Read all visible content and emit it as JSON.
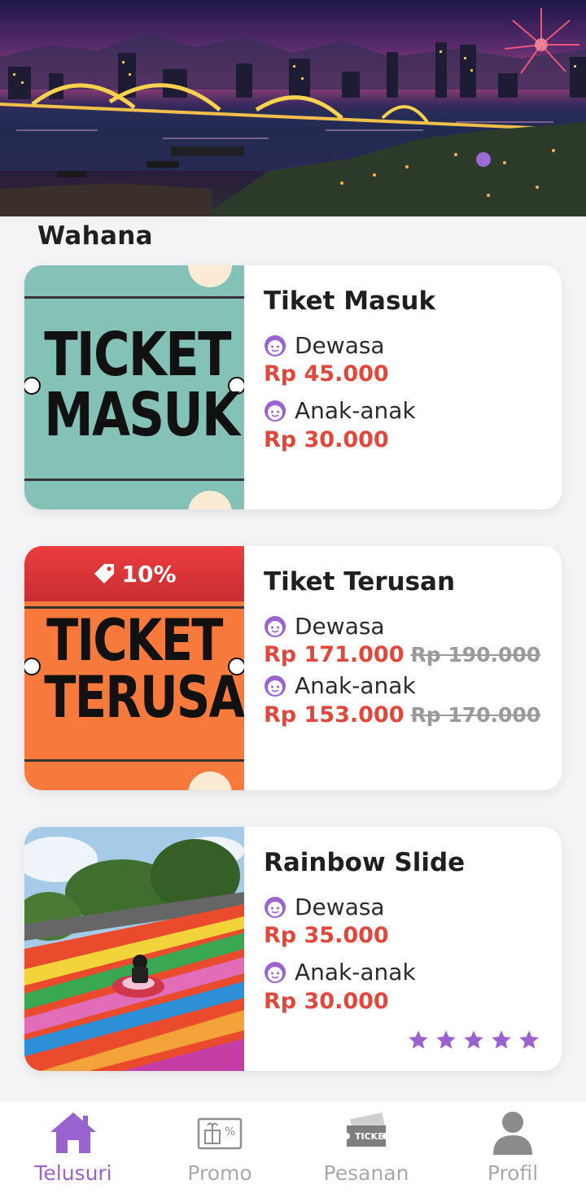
{
  "section": {
    "title": "Wahana"
  },
  "cards": [
    {
      "title": "Tiket Masuk",
      "thumb_text_1": "TICKET",
      "thumb_text_2": "MASUK",
      "adult_label": "Dewasa",
      "adult_price": "Rp 45.000",
      "child_label": "Anak-anak",
      "child_price": "Rp 30.000"
    },
    {
      "title": "Tiket Terusan",
      "discount": "10%",
      "thumb_text_1": "TICKET",
      "thumb_text_2": "TERUSAN",
      "adult_label": "Dewasa",
      "adult_price": "Rp 171.000",
      "adult_price_old": "Rp 190.000",
      "child_label": "Anak-anak",
      "child_price": "Rp 153.000",
      "child_price_old": "Rp 170.000"
    },
    {
      "title": "Rainbow Slide",
      "adult_label": "Dewasa",
      "adult_price": "Rp 35.000",
      "child_label": "Anak-anak",
      "child_price": "Rp 30.000",
      "rating": 5
    }
  ],
  "nav": [
    {
      "label": "Telusuri",
      "icon": "home-icon",
      "active": true
    },
    {
      "label": "Promo",
      "icon": "promo-icon",
      "active": false
    },
    {
      "label": "Pesanan",
      "icon": "ticket-icon",
      "active": false
    },
    {
      "label": "Profil",
      "icon": "profile-icon",
      "active": false
    }
  ],
  "colors": {
    "accent": "#9a62cf",
    "price": "#e2473b",
    "price_old": "#9a9a9a",
    "card1_bg": "#84c1b6",
    "card2_bg": "#f77a3c",
    "discount_bg": "#e53b3b"
  }
}
